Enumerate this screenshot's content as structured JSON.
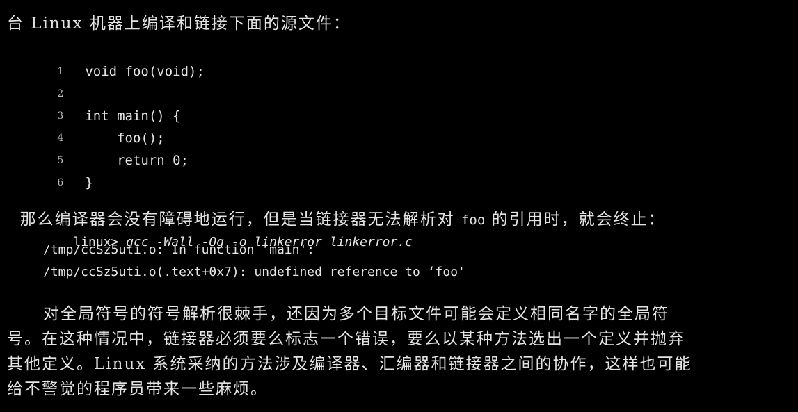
{
  "intro": {
    "text": "台 Linux 机器上编译和链接下面的源文件："
  },
  "listing": [
    {
      "num": "1",
      "code": "void foo(void);"
    },
    {
      "num": "2",
      "code": ""
    },
    {
      "num": "3",
      "code": "int main() {"
    },
    {
      "num": "4",
      "code": "    foo();"
    },
    {
      "num": "5",
      "code": "    return 0;"
    },
    {
      "num": "6",
      "code": "}"
    }
  ],
  "middle": {
    "before": "那么编译器会没有障碍地运行，但是当链接器无法解析对 ",
    "code": "foo",
    "after": " 的引用时，就会终止："
  },
  "terminal": {
    "prompt": "linux> ",
    "command": "gcc -Wall -Og -o linkerror linkerror.c",
    "out1": "/tmp/ccSz5uti.o: In function ‘main':",
    "out2": "/tmp/ccSz5uti.o(.text+0x7): undefined reference to ‘foo'"
  },
  "paragraph": {
    "line1": "对全局符号的符号解析很棘手，还因为多个目标文件可能会定义相同名字的全局符",
    "line2": "号。在这种情况中，链接器必须要么标志一个错误，要么以某种方法选出一个定义并抛弃",
    "line3": "其他定义。Linux 系统采纳的方法涉及编译器、汇编器和链接器之间的协作，这样也可能",
    "line4": "给不警觉的程序员带来一些麻烦。"
  }
}
